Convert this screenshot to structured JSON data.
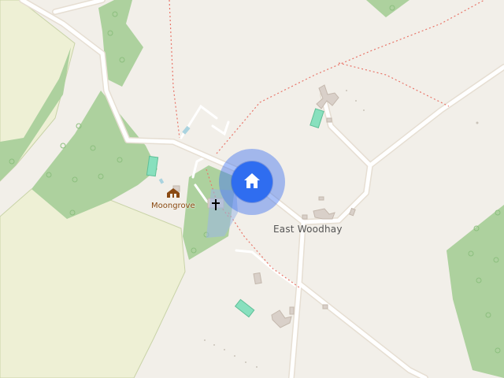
{
  "map": {
    "places": {
      "village": "East Woodhay",
      "poi": "Moongrove"
    },
    "colors": {
      "background": "#f2efe9",
      "wood": "#add19e",
      "farmland": "#eef0d5",
      "road": "#ffffff",
      "path": "#fa8072",
      "building": "#d9d0c9",
      "water": "#aad3df",
      "home_marker": "#2f6df0"
    },
    "markers": {
      "home_icon": "home-icon",
      "church_icon": "church-cross-icon",
      "poi_icon": "hut-icon"
    }
  }
}
